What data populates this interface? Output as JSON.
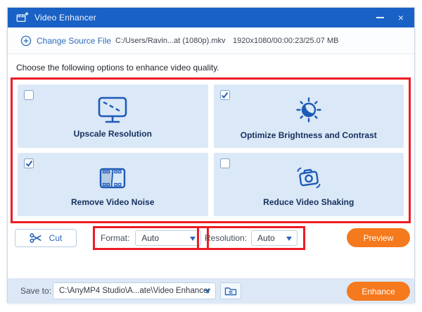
{
  "titlebar": {
    "title": "Video Enhancer",
    "close_glyph": "×"
  },
  "source_bar": {
    "change_source": "Change Source File",
    "file_path": "C:/Users/Ravin...at (1080p).mkv",
    "file_info": "1920x1080/00:00:23/25.07 MB"
  },
  "main": {
    "instruction": "Choose the following options to enhance video quality.",
    "options": [
      {
        "label": "Upscale Resolution",
        "checked": false,
        "icon": "upscale-monitor-icon"
      },
      {
        "label": "Optimize Brightness and Contrast",
        "checked": true,
        "icon": "brightness-contrast-sun-icon"
      },
      {
        "label": "Remove Video Noise",
        "checked": true,
        "icon": "video-filmstrip-icon"
      },
      {
        "label": "Reduce Video Shaking",
        "checked": false,
        "icon": "camera-shake-icon"
      }
    ]
  },
  "controls": {
    "cut": "Cut",
    "format_label": "Format:",
    "format_value": "Auto",
    "resolution_label": "Resolution:",
    "resolution_value": "Auto",
    "preview": "Preview"
  },
  "footer": {
    "save_to_label": "Save to:",
    "save_path": "C:\\AnyMP4 Studio\\A...ate\\Video Enhancer",
    "enhance": "Enhance"
  },
  "colors": {
    "titlebar_blue": "#1961c5",
    "accent_blue": "#2a66b8",
    "icon_blue": "#1e5bb8",
    "card_bg": "#dbe8f7",
    "card_text": "#15305e",
    "button_orange": "#f5791d",
    "annotation_red": "#ed1c24",
    "footer_bg": "#dce8f5"
  }
}
